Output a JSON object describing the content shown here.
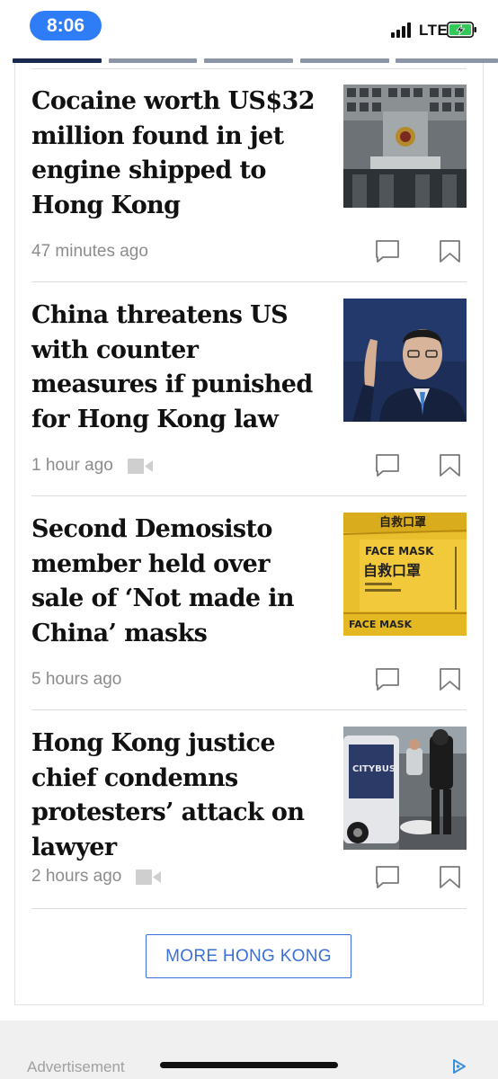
{
  "status_bar": {
    "time": "8:06",
    "network": "LTE",
    "accent_color": "#2f7df6"
  },
  "tabs": {
    "count": 5,
    "active_index": 0
  },
  "articles": [
    {
      "headline": "Cocaine worth US$32 million found in jet engine shipped to Hong Kong",
      "time_ago": "47 minutes ago",
      "has_video": false,
      "thumbnail": "building-facade-photo"
    },
    {
      "headline": "China threatens US with counter measures if punished for Hong Kong law",
      "time_ago": "1 hour ago",
      "has_video": true,
      "thumbnail": "spokesman-at-podium-photo"
    },
    {
      "headline": "Second Demosisto member held over sale of ‘Not made in China’ masks",
      "time_ago": "5 hours ago",
      "has_video": false,
      "thumbnail": "face-mask-boxes-photo",
      "thumbnail_text": {
        "line1": "FACE MASK",
        "line2": "自救口罩"
      }
    },
    {
      "headline": "Hong Kong justice chief condemns protesters’ attack on lawyer",
      "time_ago": "2 hours ago",
      "has_video": true,
      "thumbnail": "street-scuffle-bus-photo"
    }
  ],
  "more_button": {
    "label": "MORE HONG KONG",
    "color": "#3b6fd8"
  },
  "ad": {
    "label": "Advertisement"
  }
}
